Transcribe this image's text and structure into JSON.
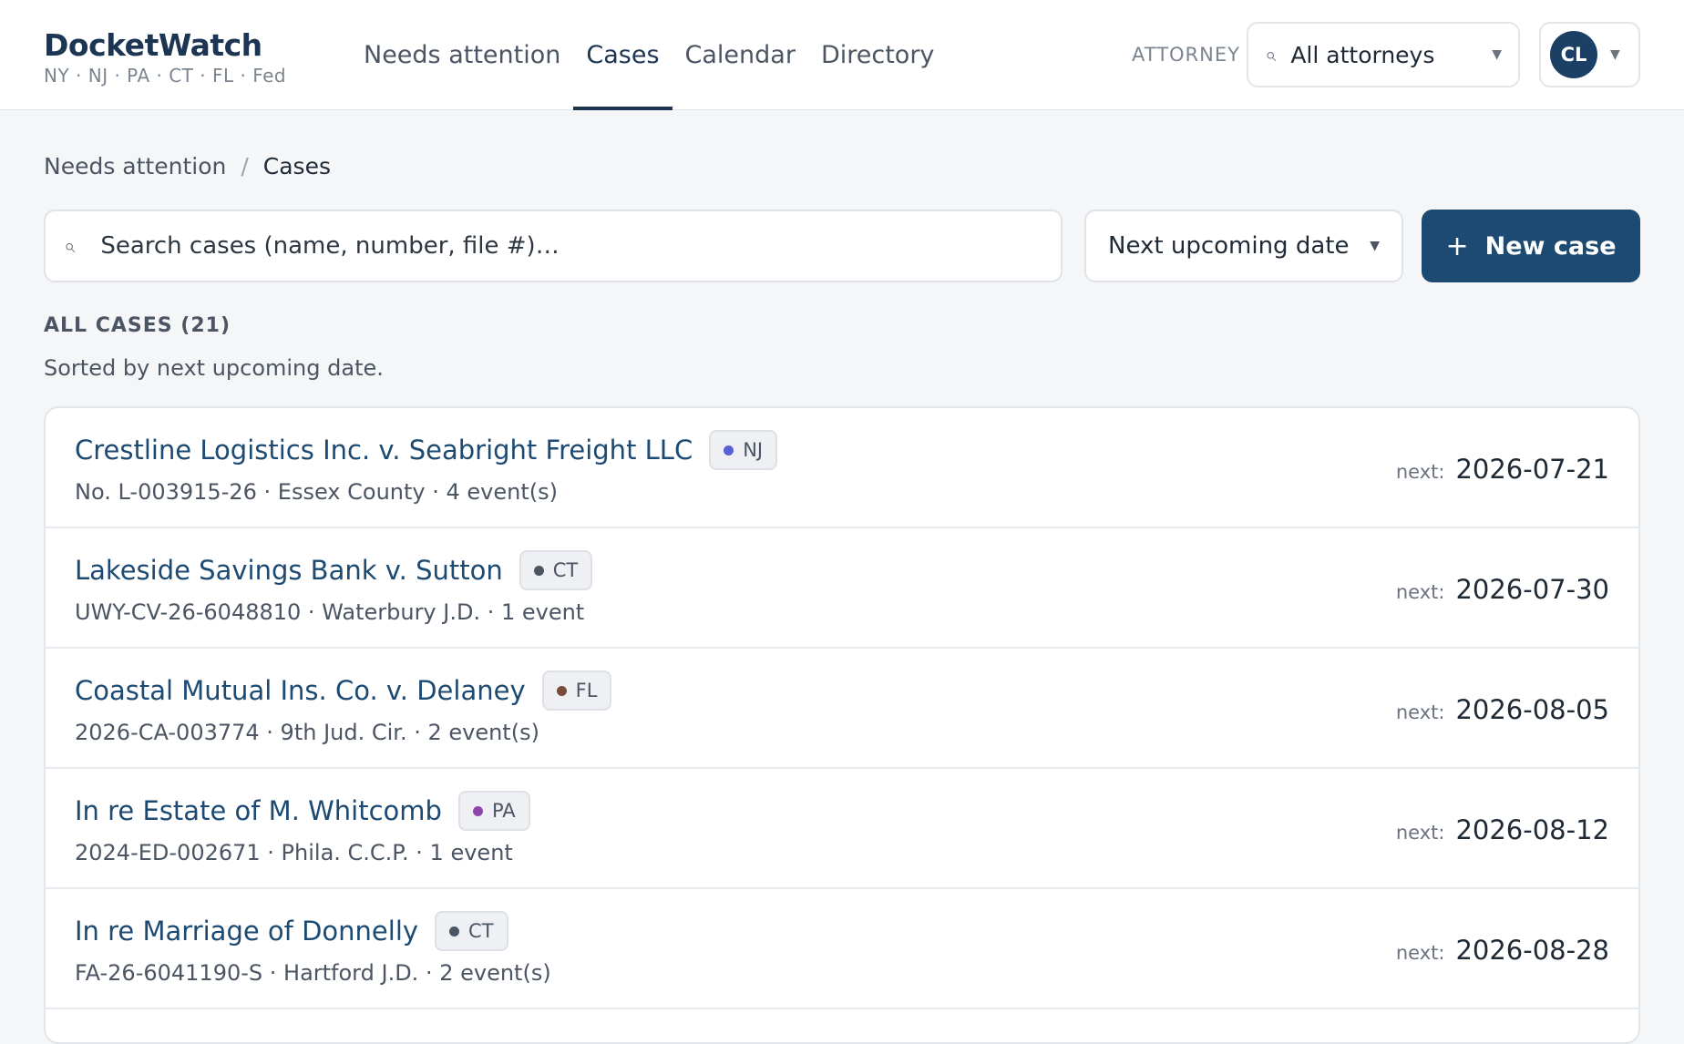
{
  "brand": {
    "name": "DocketWatch",
    "subtitle": "NY · NJ · PA · CT · FL · Fed"
  },
  "nav": [
    {
      "label": "Needs attention",
      "active": false
    },
    {
      "label": "Cases",
      "active": true
    },
    {
      "label": "Calendar",
      "active": false
    },
    {
      "label": "Directory",
      "active": false
    }
  ],
  "attorney": {
    "label": "ATTORNEY",
    "value": "All attorneys",
    "icon": "search-icon"
  },
  "user": {
    "initials": "CL"
  },
  "breadcrumb": {
    "parent": "Needs attention",
    "separator": "/",
    "current": "Cases"
  },
  "search": {
    "placeholder": "Search cases (name, number, file #)…",
    "icon": "search-icon"
  },
  "sort": {
    "value": "Next upcoming date"
  },
  "new_case": {
    "plus": "+",
    "label": "New case"
  },
  "section": {
    "title": "ALL CASES (21)",
    "subtitle": "Sorted by next upcoming date."
  },
  "colors": {
    "brand": "#1c3553",
    "primary_button": "#1c4a73",
    "link": "#1c4a73",
    "nj_dot": "#5b5fd6",
    "ct_dot": "#4b5563",
    "fl_dot": "#7a4b3a",
    "pa_dot": "#8e44ad"
  },
  "cases": [
    {
      "title": "Crestline Logistics Inc. v. Seabright Freight LLC",
      "state": "NJ",
      "dot": "#5b5fd6",
      "meta": "No. L-003915-26 · Essex County · 4 event(s)",
      "next_label": "next:",
      "next_date": "2026-07-21"
    },
    {
      "title": "Lakeside Savings Bank v. Sutton",
      "state": "CT",
      "dot": "#4b5563",
      "meta": "UWY-CV-26-6048810 · Waterbury J.D. · 1 event",
      "next_label": "next:",
      "next_date": "2026-07-30"
    },
    {
      "title": "Coastal Mutual Ins. Co. v. Delaney",
      "state": "FL",
      "dot": "#7a4b3a",
      "meta": "2026-CA-003774 · 9th Jud. Cir. · 2 event(s)",
      "next_label": "next:",
      "next_date": "2026-08-05"
    },
    {
      "title": "In re Estate of M. Whitcomb",
      "state": "PA",
      "dot": "#8e44ad",
      "meta": "2024-ED-002671 · Phila. C.C.P. · 1 event",
      "next_label": "next:",
      "next_date": "2026-08-12"
    },
    {
      "title": "In re Marriage of Donnelly",
      "state": "CT",
      "dot": "#4b5563",
      "meta": "FA-26-6041190-S · Hartford J.D. · 2 event(s)",
      "next_label": "next:",
      "next_date": "2026-08-28"
    }
  ]
}
